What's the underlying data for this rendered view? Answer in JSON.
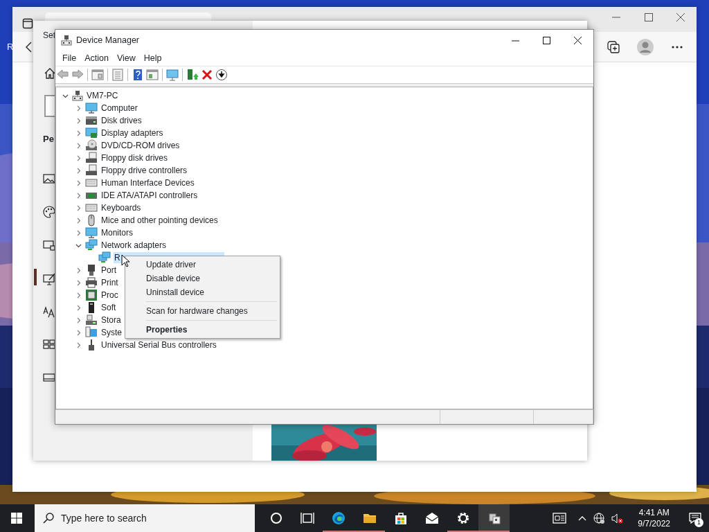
{
  "desktop": {
    "labels": [
      "R"
    ]
  },
  "settings": {
    "title": "Set",
    "heading": "Pe"
  },
  "device_manager": {
    "title": "Device Manager",
    "menu": [
      "File",
      "Action",
      "View",
      "Help"
    ],
    "tree": {
      "label": "VM7-PC",
      "expanded": true,
      "selected": false,
      "children": [
        {
          "label": "Computer",
          "expanded": false,
          "selected": false
        },
        {
          "label": "Disk drives",
          "expanded": false,
          "selected": false
        },
        {
          "label": "Display adapters",
          "expanded": false,
          "selected": false
        },
        {
          "label": "DVD/CD-ROM drives",
          "expanded": false,
          "selected": false
        },
        {
          "label": "Floppy disk drives",
          "expanded": false,
          "selected": false
        },
        {
          "label": "Floppy drive controllers",
          "expanded": false,
          "selected": false
        },
        {
          "label": "Human Interface Devices",
          "expanded": false,
          "selected": false
        },
        {
          "label": "IDE ATA/ATAPI controllers",
          "expanded": false,
          "selected": false
        },
        {
          "label": "Keyboards",
          "expanded": false,
          "selected": false
        },
        {
          "label": "Mice and other pointing devices",
          "expanded": false,
          "selected": false
        },
        {
          "label": "Monitors",
          "expanded": false,
          "selected": false
        },
        {
          "label": "Network adapters",
          "expanded": true,
          "selected": false,
          "children": [
            {
              "label": "R",
              "selected": true
            }
          ]
        },
        {
          "label": "Port",
          "expanded": false,
          "selected": false
        },
        {
          "label": "Print",
          "expanded": false,
          "selected": false
        },
        {
          "label": "Proc",
          "expanded": false,
          "selected": false
        },
        {
          "label": "Soft",
          "expanded": false,
          "selected": false
        },
        {
          "label": "Stora",
          "expanded": false,
          "selected": false
        },
        {
          "label": "Syste",
          "expanded": false,
          "selected": false
        },
        {
          "label": "Universal Serial Bus controllers",
          "expanded": false,
          "selected": false
        }
      ]
    }
  },
  "context_menu": {
    "items": [
      {
        "kind": "item",
        "label": "Update driver",
        "default": false
      },
      {
        "kind": "item",
        "label": "Disable device",
        "default": false
      },
      {
        "kind": "item",
        "label": "Uninstall device",
        "default": false
      },
      {
        "kind": "separator"
      },
      {
        "kind": "item",
        "label": "Scan for hardware changes",
        "default": false
      },
      {
        "kind": "separator"
      },
      {
        "kind": "item",
        "label": "Properties",
        "default": true
      }
    ]
  },
  "taskbar": {
    "search": {
      "placeholder": "Type here to search"
    },
    "apps": [
      {
        "running": false,
        "active": false
      },
      {
        "running": false,
        "active": false
      },
      {
        "running": true,
        "active": false
      },
      {
        "running": true,
        "active": false
      },
      {
        "running": false,
        "active": false
      },
      {
        "running": false,
        "active": false
      },
      {
        "running": true,
        "active": false
      },
      {
        "running": true,
        "active": true
      }
    ],
    "time": "4:41 AM",
    "date": "9/7/2022",
    "notifications": "1"
  }
}
